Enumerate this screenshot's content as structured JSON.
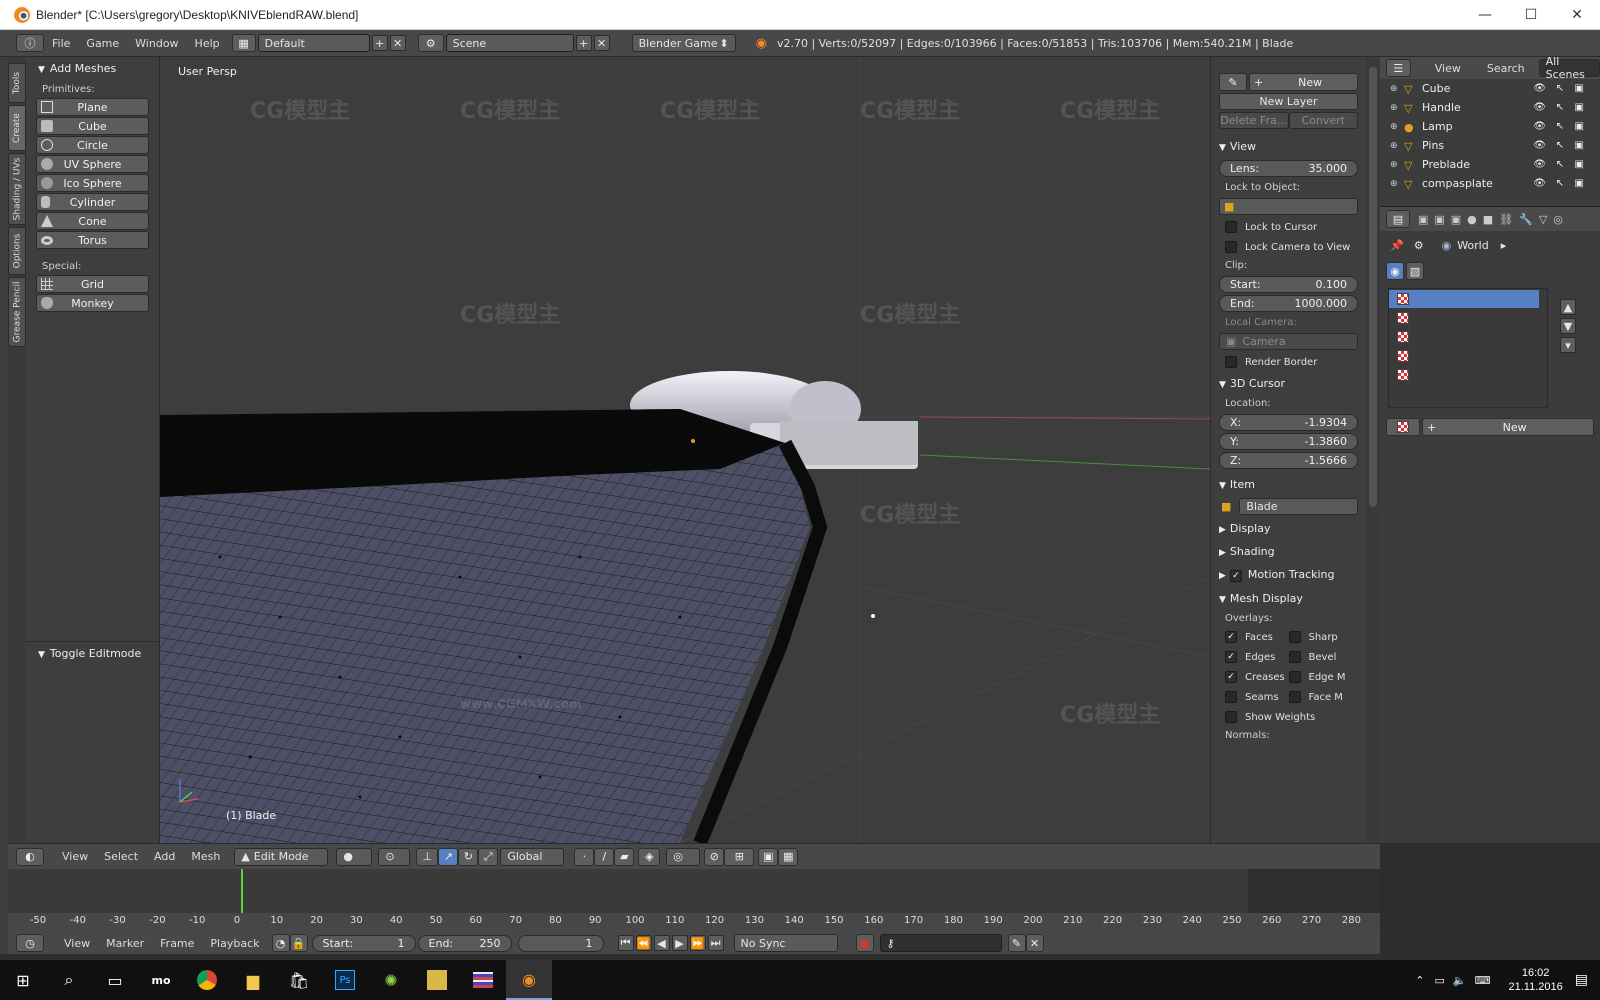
{
  "window": {
    "title": "Blender* [C:\\Users\\gregory\\Desktop\\KNIVEblendRAW.blend]",
    "minimize": "—",
    "maximize": "☐",
    "close": "✕"
  },
  "info_header": {
    "menus": [
      "File",
      "Game",
      "Window",
      "Help"
    ],
    "layout": "Default",
    "scene": "Scene",
    "engine": "Blender Game",
    "stats": "v2.70 | Verts:0/52097 | Edges:0/103966 | Faces:0/51853 | Tris:103706 | Mem:540.21M | Blade"
  },
  "side_tabs": [
    "Tools",
    "Create",
    "Shading / UVs",
    "Options",
    "Grease Pencil"
  ],
  "tool_shelf": {
    "panel_title": "Add Meshes",
    "primitives_label": "Primitives:",
    "primitives": [
      "Plane",
      "Cube",
      "Circle",
      "UV Sphere",
      "Ico Sphere",
      "Cylinder",
      "Cone",
      "Torus"
    ],
    "special_label": "Special:",
    "special": [
      "Grid",
      "Monkey"
    ],
    "toggle_editmode": "Toggle Editmode"
  },
  "viewport": {
    "view_name": "User Persp",
    "object_label": "(1) Blade",
    "watermark": "CG模型主",
    "watermark_url": "www.CGMXW.com"
  },
  "n_panel": {
    "gp_new": "New",
    "new_layer": "New Layer",
    "delete_frame": "Delete Fra...",
    "convert": "Convert",
    "view_title": "View",
    "lens_label": "Lens:",
    "lens_value": "35.000",
    "lock_to_object": "Lock to Object:",
    "lock_to_cursor": "Lock to Cursor",
    "lock_camera": "Lock Camera to View",
    "clip_label": "Clip:",
    "clip_start_label": "Start:",
    "clip_start": "0.100",
    "clip_end_label": "End:",
    "clip_end": "1000.000",
    "local_camera": "Local Camera:",
    "camera": "Camera",
    "render_border": "Render Border",
    "cursor_title": "3D Cursor",
    "location_label": "Location:",
    "x_label": "X:",
    "x": "-1.9304",
    "y_label": "Y:",
    "y": "-1.3860",
    "z_label": "Z:",
    "z": "-1.5666",
    "item_title": "Item",
    "item_name": "Blade",
    "display": "Display",
    "shading": "Shading",
    "motion_tracking": "Motion Tracking",
    "mesh_display": "Mesh Display",
    "overlays_label": "Overlays:",
    "faces": "Faces",
    "sharp": "Sharp",
    "edges": "Edges",
    "bevel": "Bevel",
    "creases": "Creases",
    "edge_m": "Edge M",
    "seams": "Seams",
    "face_m": "Face M",
    "show_weights": "Show Weights",
    "normals_label": "Normals:"
  },
  "outliner": {
    "view": "View",
    "search": "Search",
    "filter": "All Scenes",
    "items": [
      "Cube",
      "Handle",
      "Lamp",
      "Pins",
      "Preblade",
      "compasplate"
    ]
  },
  "properties": {
    "world": "World",
    "new": "New"
  },
  "viewport_header": {
    "menus": [
      "View",
      "Select",
      "Add",
      "Mesh"
    ],
    "mode": "Edit Mode",
    "orientation": "Global"
  },
  "timeline": {
    "ticks": [
      "-50",
      "-40",
      "-30",
      "-20",
      "-10",
      "0",
      "10",
      "20",
      "30",
      "40",
      "50",
      "60",
      "70",
      "80",
      "90",
      "100",
      "110",
      "120",
      "130",
      "140",
      "150",
      "160",
      "170",
      "180",
      "190",
      "200",
      "210",
      "220",
      "230",
      "240",
      "250",
      "260",
      "270",
      "280"
    ],
    "current_frame": 1,
    "menus": [
      "View",
      "Marker",
      "Frame",
      "Playback"
    ],
    "start_label": "Start:",
    "start": "1",
    "end_label": "End:",
    "end": "250",
    "frame": "1",
    "sync": "No Sync"
  },
  "taskbar": {
    "time": "16:02",
    "date": "21.11.2016"
  },
  "colors": {
    "accent": "#f08a24",
    "selected_row": "#5680c2",
    "mesh_face": "#4c4f63"
  }
}
